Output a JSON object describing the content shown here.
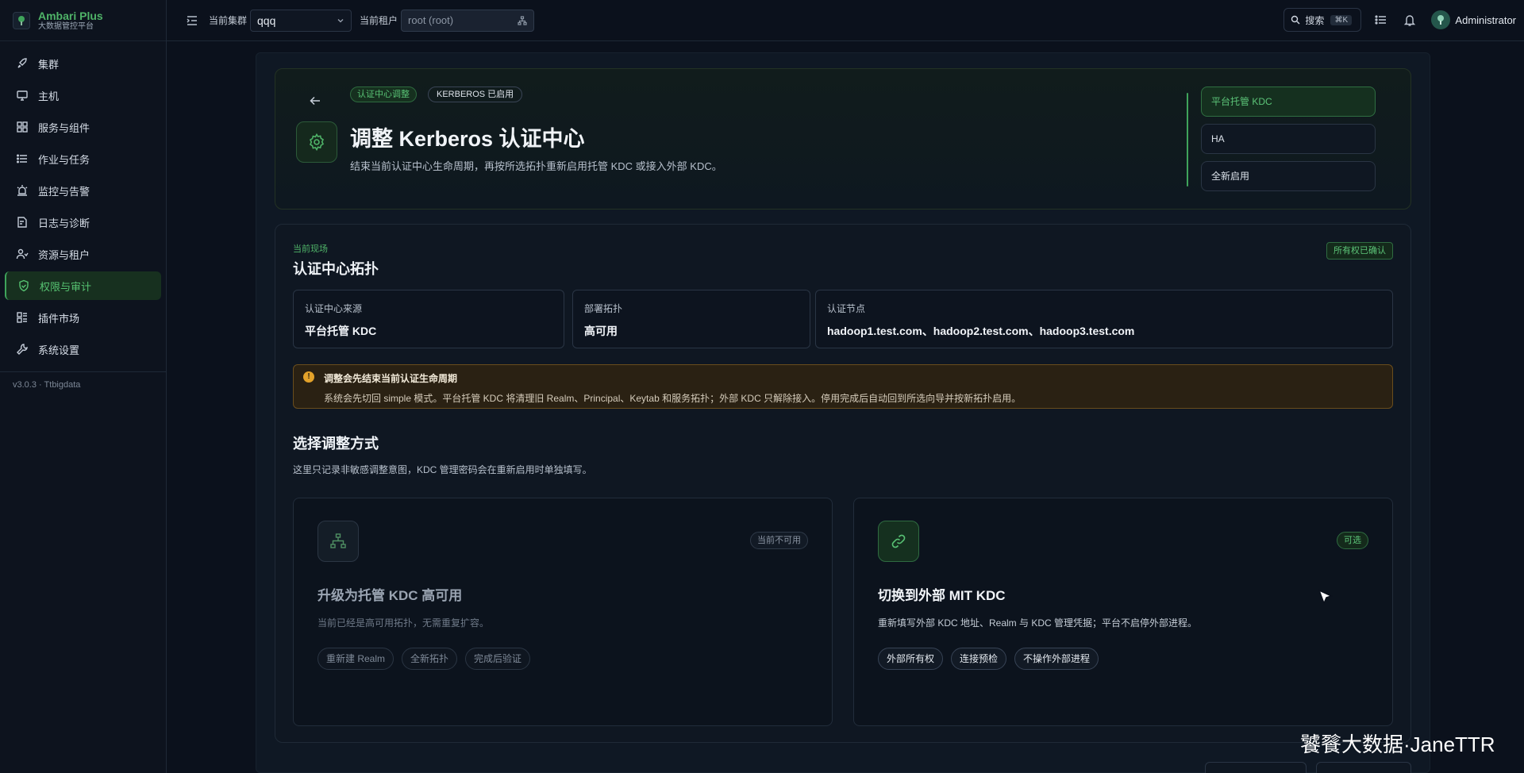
{
  "brand": {
    "name": "Ambari Plus",
    "subtitle": "大数据管控平台"
  },
  "sidebar": {
    "items": [
      {
        "label": "集群",
        "icon": "rocket-icon"
      },
      {
        "label": "主机",
        "icon": "monitor-icon"
      },
      {
        "label": "服务与组件",
        "icon": "grid-icon"
      },
      {
        "label": "作业与任务",
        "icon": "list-icon"
      },
      {
        "label": "监控与告警",
        "icon": "alarm-icon"
      },
      {
        "label": "日志与诊断",
        "icon": "log-icon"
      },
      {
        "label": "资源与租户",
        "icon": "users-icon"
      },
      {
        "label": "权限与审计",
        "icon": "shield-icon",
        "active": true
      },
      {
        "label": "插件市场",
        "icon": "plugin-icon"
      },
      {
        "label": "系统设置",
        "icon": "wrench-icon"
      }
    ],
    "version": "v3.0.3 · Ttbigdata"
  },
  "topbar": {
    "cluster_label": "当前集群",
    "cluster_value": "qqq",
    "tenant_label": "当前租户",
    "tenant_value": "root (root)",
    "search_label": "搜索",
    "search_shortcut": "⌘K",
    "user_name": "Administrator"
  },
  "hero": {
    "tag_primary": "认证中心调整",
    "tag_secondary": "KERBEROS 已启用",
    "title": "调整 Kerberos 认证中心",
    "description": "结束当前认证中心生命周期，再按所选拓扑重新启用托管 KDC 或接入外部 KDC。",
    "steps": [
      "平台托管 KDC",
      "HA",
      "全新启用"
    ]
  },
  "current": {
    "eyebrow": "当前现场",
    "title": "认证中心拓扑",
    "badge": "所有权已确认",
    "cards": [
      {
        "label": "认证中心来源",
        "value": "平台托管 KDC"
      },
      {
        "label": "部署拓扑",
        "value": "高可用"
      },
      {
        "label": "认证节点",
        "value": "hadoop1.test.com、hadoop2.test.com、hadoop3.test.com"
      }
    ]
  },
  "warning": {
    "icon": "warning-icon",
    "title": "调整会先结束当前认证生命周期",
    "text": "系统会先切回 simple 模式。平台托管 KDC 将清理旧 Realm、Principal、Keytab 和服务拓扑；外部 KDC 只解除接入。停用完成后自动回到所选向导并按新拓扑启用。"
  },
  "adjust": {
    "title": "选择调整方式",
    "description": "这里只记录非敏感调整意图，KDC 管理密码会在重新启用时单独填写。",
    "options": [
      {
        "title": "升级为托管 KDC 高可用",
        "description": "当前已经是高可用拓扑，无需重复扩容。",
        "badge": "当前不可用",
        "icon": "topology-icon",
        "chips": [
          "重新建 Realm",
          "全新拓扑",
          "完成后验证"
        ]
      },
      {
        "title": "切换到外部 MIT KDC",
        "description": "重新填写外部 KDC 地址、Realm 与 KDC 管理凭据；平台不启停外部进程。",
        "badge": "可选",
        "icon": "link-icon",
        "chips": [
          "外部所有权",
          "连接预检",
          "不操作外部进程"
        ]
      }
    ]
  },
  "watermark": "饕餮大数据·JaneTTR",
  "colors": {
    "accent": "#4fb368",
    "background": "#0b111c",
    "warning": "#e3a22a"
  }
}
